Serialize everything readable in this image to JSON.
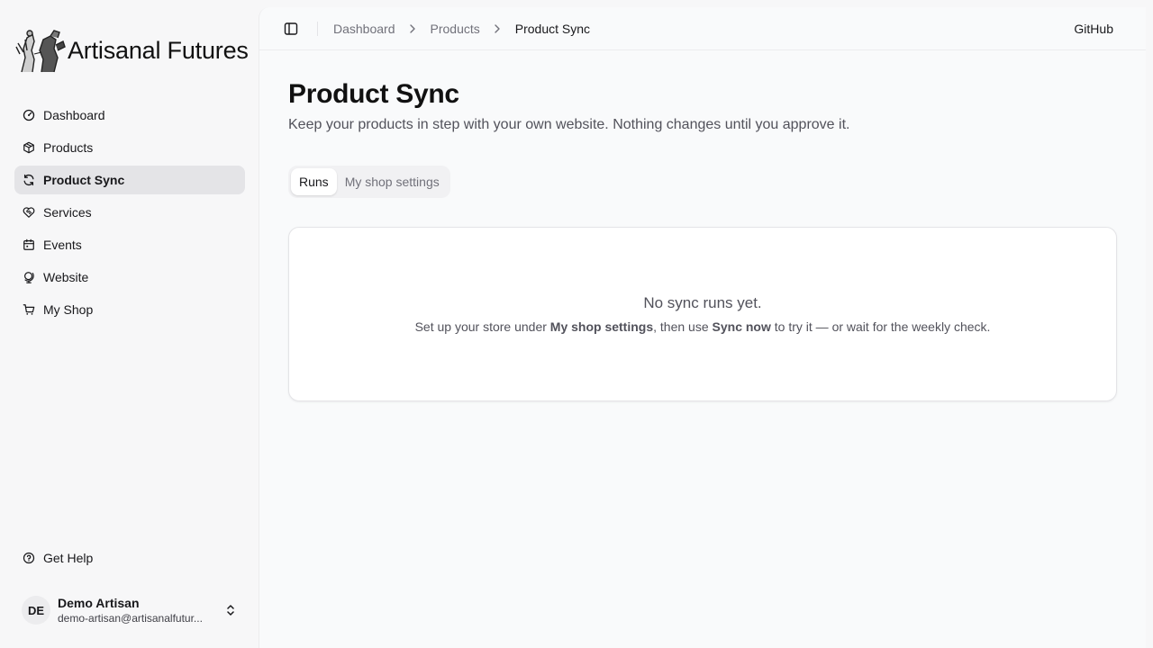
{
  "brand": {
    "name": "Artisanal Futures"
  },
  "sidebar": {
    "items": [
      {
        "label": "Dashboard",
        "icon": "gauge-icon"
      },
      {
        "label": "Products",
        "icon": "package-icon"
      },
      {
        "label": "Product Sync",
        "icon": "refresh-icon",
        "active": true
      },
      {
        "label": "Services",
        "icon": "heart-handshake-icon"
      },
      {
        "label": "Events",
        "icon": "calendar-icon"
      },
      {
        "label": "Website",
        "icon": "globe-icon"
      },
      {
        "label": "My Shop",
        "icon": "shopping-cart-icon"
      }
    ],
    "help": {
      "label": "Get Help",
      "icon": "help-circle-icon"
    },
    "user": {
      "initials": "DE",
      "name": "Demo Artisan",
      "email": "demo-artisan@artisanalfutur..."
    }
  },
  "header": {
    "breadcrumbs": [
      "Dashboard",
      "Products",
      "Product Sync"
    ],
    "github": "GitHub"
  },
  "page": {
    "title": "Product Sync",
    "subtitle": "Keep your products in step with your own website. Nothing changes until you approve it.",
    "tabs": [
      {
        "label": "Runs",
        "active": true
      },
      {
        "label": "My shop settings",
        "active": false
      }
    ],
    "empty": {
      "title": "No sync runs yet.",
      "desc_1": "Set up your store under ",
      "desc_bold_1": "My shop settings",
      "desc_2": ", then use ",
      "desc_bold_2": "Sync now",
      "desc_3": " to try it — or wait for the weekly check."
    }
  },
  "colors": {
    "background": "#f7f7f8",
    "main_background": "#f9fafb",
    "active_nav": "#e4e4e7",
    "text": "#18181b",
    "muted": "#71717a"
  }
}
